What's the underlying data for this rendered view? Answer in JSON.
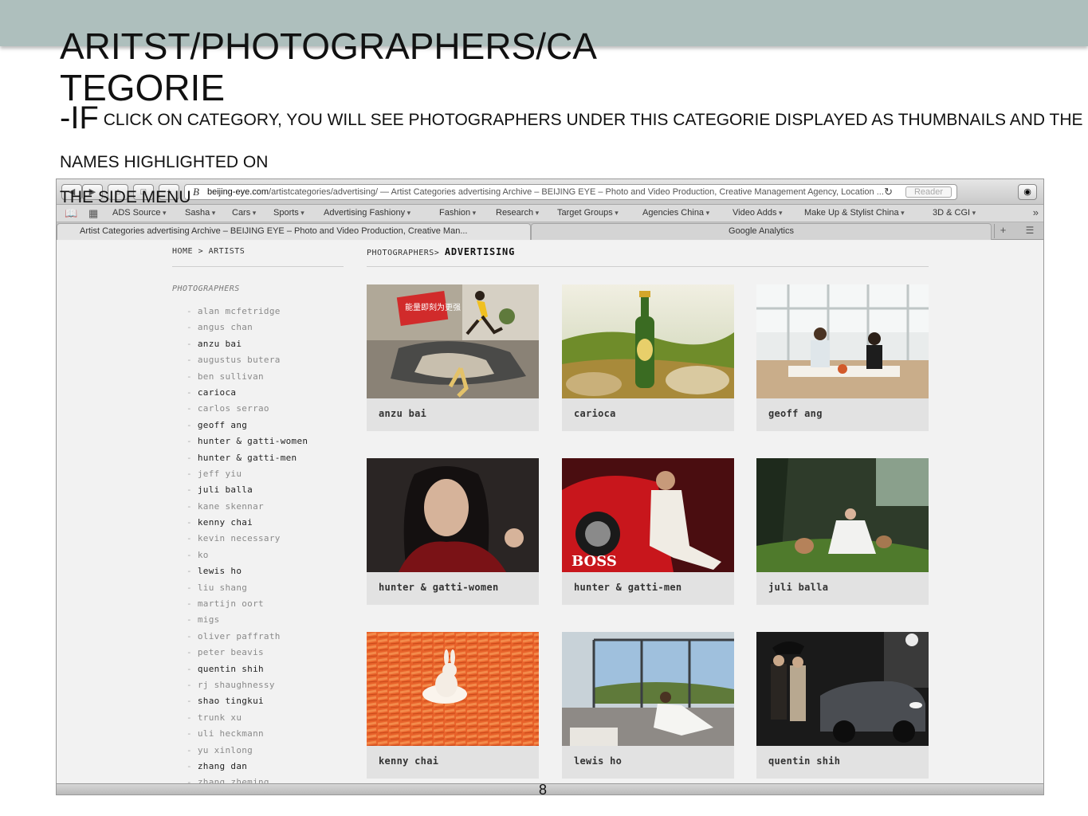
{
  "slide": {
    "title": "ARITST/PHOTOGRAPHERS/CATEGORIE",
    "bullet_prefix": "-IF",
    "bullet_text": "CLICK ON CATEGORY, YOU WILL SEE PHOTOGRAPHERS UNDER THIS CATEGORIE DISPLAYED AS THUMBNAILS AND THE",
    "bullet_cont1": "NAMES HIGHLIGHTED ON",
    "bullet_cont2": "THE SIDE MENU",
    "page_number": "8",
    "band_color": "#aebfbd"
  },
  "browser": {
    "url_domain": "beijing-eye.com",
    "url_path": "/artistcategories/advertising/ — Artist Categories advertising Archive – BEIJING EYE – Photo and Video Production, Creative Management Agency, Location ...",
    "reader_label": "Reader",
    "bookmarks": [
      "ADS Source",
      "Sasha",
      "Cars",
      "Sports",
      "Advertising Fashiony",
      "Fashion",
      "Research",
      "Target Groups",
      "Agencies China",
      "Video Adds",
      "Make Up & Stylist China",
      "3D & CGI"
    ],
    "tabs": [
      "Artist Categories advertising Archive – BEIJING EYE – Photo and Video Production, Creative Man...",
      "Google Analytics"
    ]
  },
  "site": {
    "breadcrumb_left": "HOME > ARTISTS",
    "side_heading": "PHOTOGRAPHERS",
    "breadcrumb_right_prefix": "PHOTOGRAPHERS>",
    "breadcrumb_right_current": "ADVERTISING",
    "photographers": [
      {
        "name": "alan mcfetridge",
        "highlighted": false
      },
      {
        "name": "angus chan",
        "highlighted": false
      },
      {
        "name": "anzu bai",
        "highlighted": true
      },
      {
        "name": "augustus butera",
        "highlighted": false
      },
      {
        "name": "ben sullivan",
        "highlighted": false
      },
      {
        "name": "carioca",
        "highlighted": true
      },
      {
        "name": "carlos serrao",
        "highlighted": false
      },
      {
        "name": "geoff ang",
        "highlighted": true
      },
      {
        "name": "hunter & gatti-women",
        "highlighted": true
      },
      {
        "name": "hunter & gatti-men",
        "highlighted": true
      },
      {
        "name": "jeff yiu",
        "highlighted": false
      },
      {
        "name": "juli balla",
        "highlighted": true
      },
      {
        "name": "kane skennar",
        "highlighted": false
      },
      {
        "name": "kenny chai",
        "highlighted": true
      },
      {
        "name": "kevin necessary",
        "highlighted": false
      },
      {
        "name": "ko",
        "highlighted": false
      },
      {
        "name": "lewis ho",
        "highlighted": true
      },
      {
        "name": "liu shang",
        "highlighted": false
      },
      {
        "name": "martijn oort",
        "highlighted": false
      },
      {
        "name": "migs",
        "highlighted": false
      },
      {
        "name": "oliver paffrath",
        "highlighted": false
      },
      {
        "name": "peter beavis",
        "highlighted": false
      },
      {
        "name": "quentin shih",
        "highlighted": true
      },
      {
        "name": "rj shaughnessy",
        "highlighted": false
      },
      {
        "name": "shao tingkui",
        "highlighted": true
      },
      {
        "name": "trunk xu",
        "highlighted": false
      },
      {
        "name": "uli heckmann",
        "highlighted": false
      },
      {
        "name": "yu xinlong",
        "highlighted": false
      },
      {
        "name": "zhang dan",
        "highlighted": true
      },
      {
        "name": "zhang zheming",
        "highlighted": false
      }
    ],
    "cards": [
      {
        "caption": "anzu bai",
        "thumb_text": "能量即刻为更强"
      },
      {
        "caption": "carioca",
        "thumb_text": ""
      },
      {
        "caption": "geoff ang",
        "thumb_text": ""
      },
      {
        "caption": "hunter & gatti-women",
        "thumb_text": ""
      },
      {
        "caption": "hunter & gatti-men",
        "thumb_text": "BOSS"
      },
      {
        "caption": "juli balla",
        "thumb_text": ""
      },
      {
        "caption": "kenny chai",
        "thumb_text": ""
      },
      {
        "caption": "lewis ho",
        "thumb_text": ""
      },
      {
        "caption": "quentin shih",
        "thumb_text": ""
      }
    ]
  }
}
